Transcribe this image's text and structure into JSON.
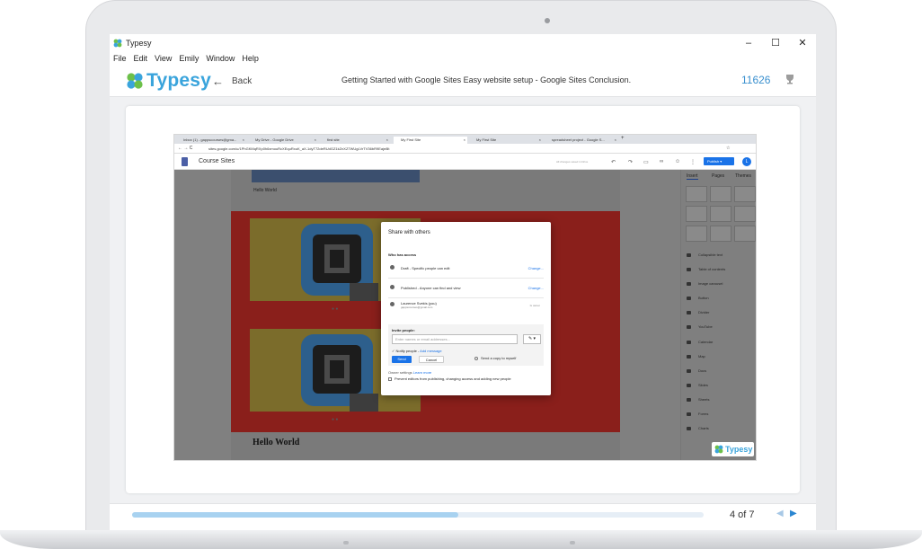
{
  "window": {
    "title": "Typesy",
    "controls": {
      "minimize": "–",
      "maximize": "☐",
      "close": "✕"
    }
  },
  "menu": [
    "File",
    "Edit",
    "View",
    "Emily",
    "Window",
    "Help"
  ],
  "header": {
    "logo_text": "Typesy",
    "back_label": "Back",
    "course_title": "Getting Started with Google Sites Easy website setup - Google Sites Conclusion.",
    "points": "11626",
    "trophy_icon": "trophy-icon"
  },
  "browser": {
    "tabs": [
      {
        "label": "Inbox (1) - gappscourses@gma..."
      },
      {
        "label": "My Drive - Google Drive"
      },
      {
        "label": "first site"
      },
      {
        "label": "My First Site"
      },
      {
        "label": "My First Site"
      },
      {
        "label": "spreadsheet project - Google S..."
      }
    ],
    "url": "sites.google.com/u/1PhGKMqRXp0h6xmouRcXEquRxuK_aX-1dyT72deRUdGZ1kZnXZ7WUgLVrTV36bR9Eaje8lt"
  },
  "sites": {
    "title": "Course Sites",
    "status": "All changes saved in Drive",
    "publish_label": "Publish",
    "avatar_letter": "L",
    "hello_small": "Hello World",
    "hello_big": "Hello World",
    "carousel_dots": "● ●"
  },
  "panel": {
    "tabs": [
      "Insert",
      "Pages",
      "Themes"
    ],
    "items": [
      "Collapsible text",
      "Table of contents",
      "Image carousel",
      "Button",
      "Divider",
      "YouTube",
      "Calendar",
      "Map",
      "Docs",
      "Slides",
      "Sheets",
      "Forms",
      "Charts"
    ]
  },
  "dialog": {
    "title": "Share with others",
    "who_has_access": "Who has access",
    "draft_label": "Draft - Specific people can edit",
    "published_label": "Published - Anyone can find and view",
    "change_label": "Change...",
    "owner_name": "Laurence Svekis (you)",
    "owner_email": "gappscourses@gmail.com",
    "owner_role": "Is owner",
    "invite_label": "Invite people:",
    "invite_placeholder": "Enter names or email addresses...",
    "notify_text": "Notify people - ",
    "add_message": "Add message",
    "send_label": "Send",
    "cancel_label": "Cancel",
    "copy_me": "Send a copy to myself",
    "owner_settings": "Owner settings ",
    "learn_more": "Learn more",
    "prevent_text": "Prevent editors from publishing, changing access and adding new people"
  },
  "overlay_logo": "Typesy",
  "footer": {
    "progress": 0.57,
    "page_count": "4 of 7",
    "prev_icon": "◀",
    "next_icon": "▶"
  }
}
